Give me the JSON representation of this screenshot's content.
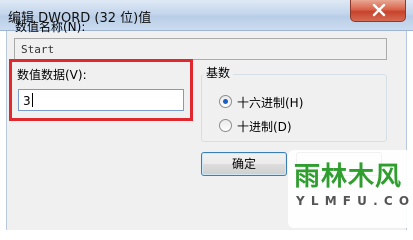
{
  "window": {
    "title": "编辑 DWORD (32 位)值",
    "close_icon": "close-icon"
  },
  "value_name": {
    "label": "数值名称(N):",
    "value": "Start"
  },
  "value_data": {
    "label": "数值数据(V):",
    "value": "3",
    "highlight_color": "#e0282e"
  },
  "base": {
    "title": "基数",
    "options": [
      {
        "label": "十六进制(H)",
        "selected": true
      },
      {
        "label": "十进制(D)",
        "selected": false
      }
    ]
  },
  "buttons": {
    "ok": "确定",
    "cancel": ""
  },
  "watermark": {
    "main": "雨林木风",
    "sub": "Y L M F U . C O M"
  }
}
